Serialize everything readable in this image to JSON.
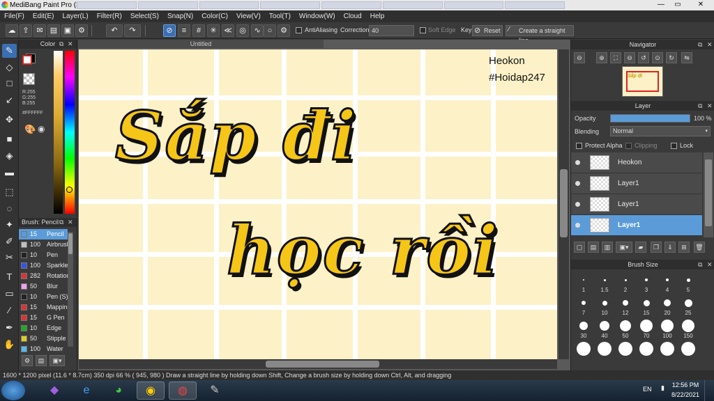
{
  "window": {
    "title": "MediBang Paint Pro (32bit)",
    "min": "—",
    "max": "▭",
    "close": "✕"
  },
  "menu": [
    "File(F)",
    "Edit(E)",
    "Layer(L)",
    "Filter(R)",
    "Select(S)",
    "Snap(N)",
    "Color(C)",
    "View(V)",
    "Tool(T)",
    "Window(W)",
    "Cloud",
    "Help"
  ],
  "toolbar": {
    "antialiasing_label": "AntiAliasing",
    "correction_label": "Correction",
    "correction_value": "40",
    "softedge_label": "Soft Edge",
    "key_label": "Key",
    "reset_label": "Reset",
    "straight_line_label": "Create a straight line"
  },
  "color_panel": {
    "title": "Color",
    "r": "R:255",
    "g": "G:255",
    "b": "B:255",
    "hex": "#FFFFFF",
    "primary": "#ffffff",
    "secondary": "#000000"
  },
  "brush_panel": {
    "title": "Brush: Pencil",
    "items": [
      {
        "size": "15",
        "name": "Pencil",
        "color": "#5b9bd8",
        "selected": true
      },
      {
        "size": "100",
        "name": "Airbrush",
        "color": "#c0c0c0"
      },
      {
        "size": "10",
        "name": "Pen",
        "color": "#222222"
      },
      {
        "size": "100",
        "name": "Sparkle",
        "color": "#3355ee"
      },
      {
        "size": "282",
        "name": "Rotation",
        "color": "#dd3333"
      },
      {
        "size": "50",
        "name": "Blur",
        "color": "#f0a0f0"
      },
      {
        "size": "10",
        "name": "Pen (S)",
        "color": "#222222"
      },
      {
        "size": "15",
        "name": "Mapping",
        "color": "#dd3333"
      },
      {
        "size": "15",
        "name": "G Pen",
        "color": "#dd3333"
      },
      {
        "size": "10",
        "name": "Edge",
        "color": "#22aa22"
      },
      {
        "size": "50",
        "name": "Stipple",
        "color": "#ddcc22"
      },
      {
        "size": "100",
        "name": "Water",
        "color": "#55bbee"
      }
    ]
  },
  "canvas": {
    "tab_title": "Untitled",
    "text_line1": "Heokon",
    "text_line2": "#Hoidap247",
    "lettering_1": "Sắp đi",
    "lettering_2": "học rồi",
    "background": "#fcf1c7",
    "lettering_color": "#f5c518"
  },
  "navigator": {
    "title": "Navigator"
  },
  "layer_panel": {
    "title": "Layer",
    "opacity_label": "Opacity",
    "opacity_value": "100 %",
    "opacity_level": 1.0,
    "blending_label": "Blending",
    "blending_value": "Normal",
    "protect_alpha": "Protect Alpha",
    "clipping": "Clipping",
    "lock": "Lock",
    "layers": [
      {
        "name": "Heokon",
        "selected": false
      },
      {
        "name": "Layer1",
        "selected": false
      },
      {
        "name": "Layer1",
        "selected": false
      },
      {
        "name": "Layer1",
        "selected": true
      }
    ]
  },
  "brush_size": {
    "title": "Brush Size",
    "sizes": [
      "1",
      "1.5",
      "2",
      "3",
      "4",
      "5",
      "7",
      "10",
      "12",
      "15",
      "20",
      "25",
      "30",
      "40",
      "50",
      "70",
      "100",
      "150"
    ]
  },
  "status": {
    "text": "1600 * 1200 pixel  (11.6 * 8.7cm)   350 dpi   66 %   ( 945, 980 )   Draw a straight line by holding down Shift, Change a brush size by holding down Ctrl, Alt, and dragging"
  },
  "taskbar": {
    "lang": "EN",
    "time": "12:56 PM",
    "date": "8/22/2021"
  }
}
